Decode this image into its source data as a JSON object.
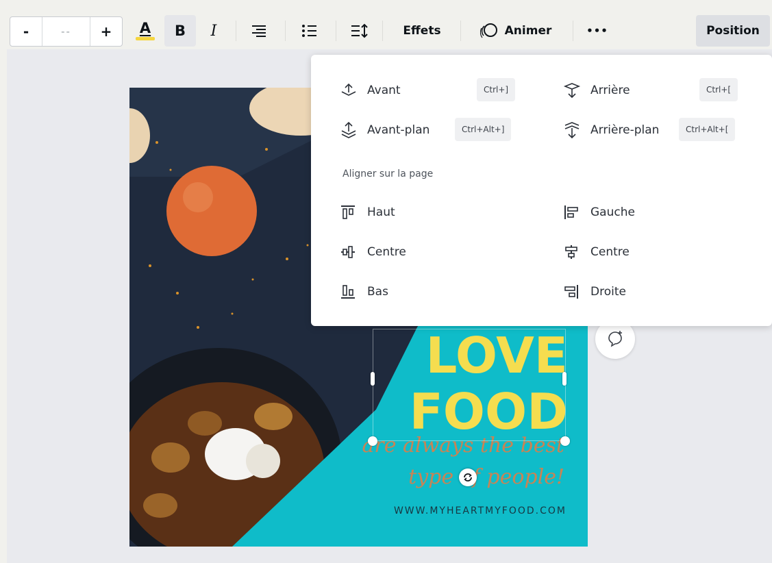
{
  "toolbar": {
    "font_size_minus": "-",
    "font_size_value": "--",
    "font_size_plus": "+",
    "text_color_letter": "A",
    "bold_letter": "B",
    "italic_letter": "I",
    "effects_label": "Effets",
    "animate_label": "Animer",
    "more_label": "•••",
    "position_label": "Position",
    "text_color_hex": "#f5d53f"
  },
  "position_menu": {
    "layer_items": [
      {
        "label": "Avant",
        "shortcut": "Ctrl+]"
      },
      {
        "label": "Avant-plan",
        "shortcut": "Ctrl+Alt+]"
      },
      {
        "label": "Arrière",
        "shortcut": "Ctrl+["
      },
      {
        "label": "Arrière-plan",
        "shortcut": "Ctrl+Alt+["
      }
    ],
    "align_heading": "Aligner sur la page",
    "align_items": [
      {
        "label": "Haut"
      },
      {
        "label": "Centre"
      },
      {
        "label": "Bas"
      },
      {
        "label": "Gauche"
      },
      {
        "label": "Centre"
      },
      {
        "label": "Droite"
      }
    ]
  },
  "design": {
    "headline_line1": "LOVE",
    "headline_line2": "FOOD",
    "tagline_line1": "are always the best",
    "tagline_line2": "type of people!",
    "url": "WWW.MYHEARTMYFOOD.COM",
    "colors": {
      "background": "#0fbcc9",
      "headline": "#f5dd4f",
      "tagline": "#c88455"
    }
  }
}
